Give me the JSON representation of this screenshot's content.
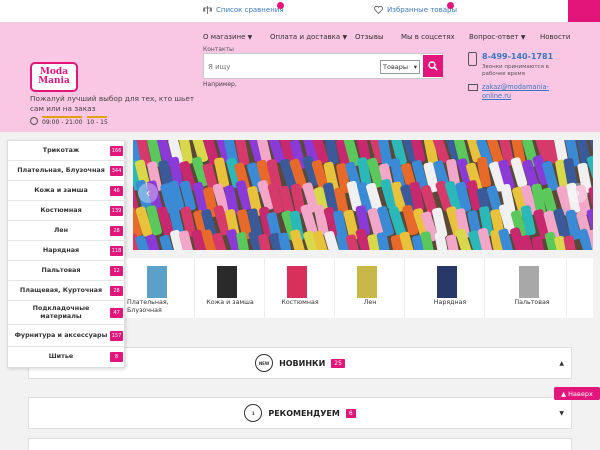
{
  "topbar": {
    "compare_label": "Список сравнения",
    "favorites_label": "Избранные товары"
  },
  "header": {
    "logo_line1": "Moda",
    "logo_line2": "Mania",
    "tagline": "Пожалуй лучший выбор для тех, кто шьет сам или на заказ",
    "hours_weekday": "09:00 - 21:00",
    "hours_weekend": "10 - 15",
    "contacts_label": "Контакты",
    "search_placeholder": "Я ищу",
    "search_scope": "Товары",
    "example_label": "Например,",
    "phone": "8-499-140-1781",
    "phone_note": "Звонки принимаются в рабочее время",
    "email": "zakaz@modamania-online.ru"
  },
  "nav": {
    "items": [
      {
        "label": "О магазине",
        "has_caret": true
      },
      {
        "label": "Оплата и доставка",
        "has_caret": true
      },
      {
        "label": "Отзывы",
        "has_caret": false
      },
      {
        "label": "Мы в соцсетях",
        "has_caret": false
      },
      {
        "label": "Вопрос-ответ",
        "has_caret": true
      },
      {
        "label": "Новости",
        "has_caret": false
      }
    ]
  },
  "sidebar": {
    "items": [
      {
        "label": "Трикотаж",
        "count": "166"
      },
      {
        "label": "Плательная, Блузочная",
        "count": "344"
      },
      {
        "label": "Кожа и замша",
        "count": "46"
      },
      {
        "label": "Костюмная",
        "count": "139"
      },
      {
        "label": "Лен",
        "count": "28"
      },
      {
        "label": "Нарядная",
        "count": "118"
      },
      {
        "label": "Пальтовая",
        "count": "12"
      },
      {
        "label": "Плащевая, Курточная",
        "count": "28"
      },
      {
        "label": "Подкладочные материалы",
        "count": "47"
      },
      {
        "label": "Фурнитура и аксессуары",
        "count": "157"
      },
      {
        "label": "Шитье",
        "count": "8"
      }
    ]
  },
  "thumbs": [
    {
      "label": "Плательная, Блузочная",
      "color": "#5aa0c8"
    },
    {
      "label": "Кожа и замша",
      "color": "#2a2a2a"
    },
    {
      "label": "Костюмная",
      "color": "#d8305a"
    },
    {
      "label": "Лен",
      "color": "#c8b848"
    },
    {
      "label": "Нарядная",
      "color": "#283868"
    },
    {
      "label": "Пальтовая",
      "color": "#a8a8a8"
    }
  ],
  "sections": [
    {
      "icon_text": "NEW",
      "title": "НОВИНКИ",
      "count": "25"
    },
    {
      "icon_text": "1",
      "title": "РЕКОМЕНДУЕМ",
      "count": "6"
    }
  ],
  "back_to_top": "Наверх",
  "colors": {
    "accent": "#e2157a",
    "header_bg": "#f9c6e3",
    "link": "#3a78c2"
  }
}
